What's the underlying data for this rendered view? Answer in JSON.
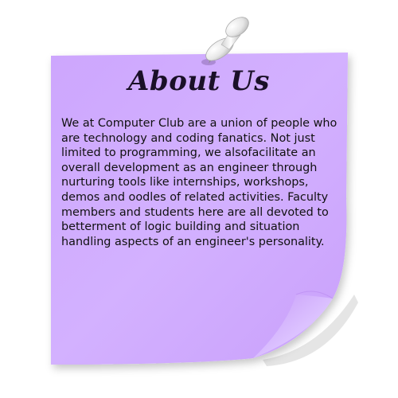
{
  "note": {
    "title": "About Us",
    "body": "We at Computer Club are a union of people who are technology and coding fanatics. Not just limited to programming, we alsofacilitate an overall development as an engineer through nurturing tools like internships, workshops, demos and oodles of related activities. Faculty members and students here are all devoted to betterment of logic building and situation handling aspects of an engineer's personality."
  },
  "colors": {
    "paper_light": "#d6b4ff",
    "paper_mid": "#c69dfb",
    "paper_curl": "#e3cdff",
    "pin_body": "#e8e8e8",
    "text": "#111111"
  },
  "icons": {
    "pin": "push-pin-icon"
  }
}
